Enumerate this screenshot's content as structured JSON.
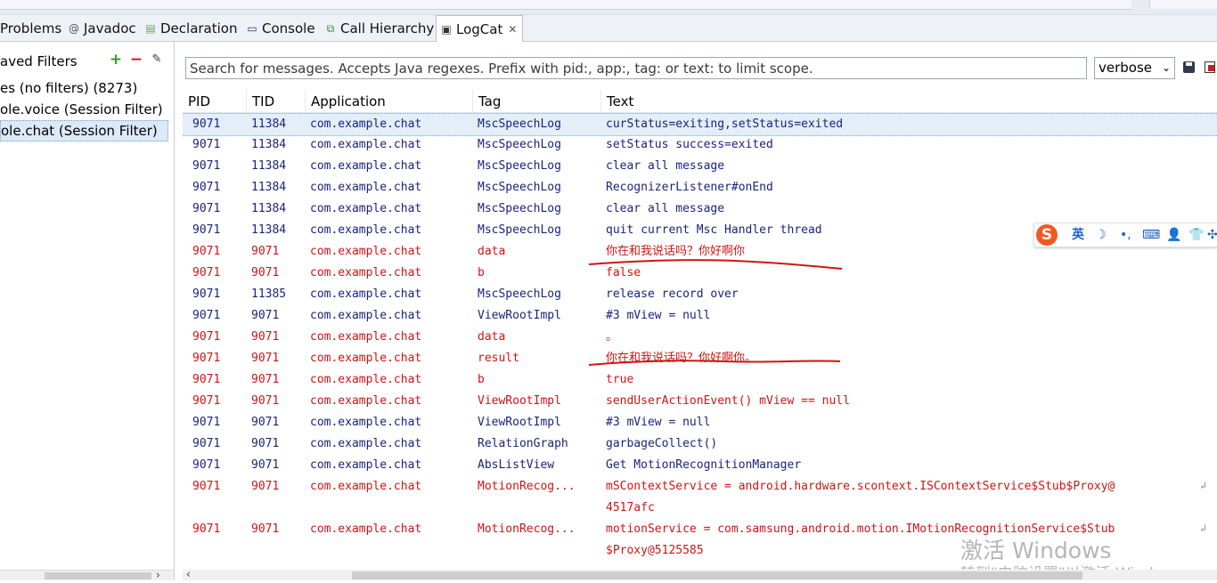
{
  "tabs": [
    {
      "label": "Problems",
      "icon": "problems-icon",
      "glyph": ""
    },
    {
      "label": "Javadoc",
      "icon": "javadoc-icon",
      "glyph": "@"
    },
    {
      "label": "Declaration",
      "icon": "declaration-icon",
      "glyph": "▤"
    },
    {
      "label": "Console",
      "icon": "console-icon",
      "glyph": "▭"
    },
    {
      "label": "Call Hierarchy",
      "icon": "call-hierarchy-icon",
      "glyph": "⧉"
    },
    {
      "label": "LogCat",
      "icon": "logcat-icon",
      "glyph": "▣",
      "close": "✕"
    }
  ],
  "filters": {
    "header": "aved Filters",
    "items": [
      "es (no filters) (8273)",
      "ole.voice (Session Filter)",
      "ole.chat (Session Filter)"
    ],
    "scroll_arrow": "›"
  },
  "search": {
    "placeholder": "Search for messages. Accepts Java regexes. Prefix with pid:, app:, tag: or text: to limit scope."
  },
  "log_level": {
    "value": "verbose"
  },
  "columns": [
    "PID",
    "TID",
    "Application",
    "Tag",
    "Text"
  ],
  "rows": [
    {
      "pid": "9071",
      "tid": "11384",
      "app": "com.example.chat",
      "tag": "MscSpeechLog",
      "text": "curStatus=exiting,setStatus=exited",
      "level": "d",
      "selected": true
    },
    {
      "pid": "9071",
      "tid": "11384",
      "app": "com.example.chat",
      "tag": "MscSpeechLog",
      "text": "setStatus success=exited",
      "level": "d"
    },
    {
      "pid": "9071",
      "tid": "11384",
      "app": "com.example.chat",
      "tag": "MscSpeechLog",
      "text": "clear all message",
      "level": "d"
    },
    {
      "pid": "9071",
      "tid": "11384",
      "app": "com.example.chat",
      "tag": "MscSpeechLog",
      "text": "RecognizerListener#onEnd",
      "level": "d"
    },
    {
      "pid": "9071",
      "tid": "11384",
      "app": "com.example.chat",
      "tag": "MscSpeechLog",
      "text": "clear all message",
      "level": "d"
    },
    {
      "pid": "9071",
      "tid": "11384",
      "app": "com.example.chat",
      "tag": "MscSpeechLog",
      "text": "quit current Msc Handler thread",
      "level": "d"
    },
    {
      "pid": "9071",
      "tid": "9071",
      "app": "com.example.chat",
      "tag": "data",
      "text": "你在和我说话吗？你好啊你",
      "level": "e"
    },
    {
      "pid": "9071",
      "tid": "9071",
      "app": "com.example.chat",
      "tag": "b",
      "text": "false",
      "level": "e"
    },
    {
      "pid": "9071",
      "tid": "11385",
      "app": "com.example.chat",
      "tag": "MscSpeechLog",
      "text": "release record over",
      "level": "d"
    },
    {
      "pid": "9071",
      "tid": "9071",
      "app": "com.example.chat",
      "tag": "ViewRootImpl",
      "text": "#3 mView = null",
      "level": "d"
    },
    {
      "pid": "9071",
      "tid": "9071",
      "app": "com.example.chat",
      "tag": "data",
      "text": "。",
      "level": "e"
    },
    {
      "pid": "9071",
      "tid": "9071",
      "app": "com.example.chat",
      "tag": "result",
      "text": "你在和我说话吗？你好啊你。",
      "level": "e"
    },
    {
      "pid": "9071",
      "tid": "9071",
      "app": "com.example.chat",
      "tag": "b",
      "text": "true",
      "level": "e"
    },
    {
      "pid": "9071",
      "tid": "9071",
      "app": "com.example.chat",
      "tag": "ViewRootImpl",
      "text": "sendUserActionEvent() mView == null",
      "level": "e"
    },
    {
      "pid": "9071",
      "tid": "9071",
      "app": "com.example.chat",
      "tag": "ViewRootImpl",
      "text": "#3 mView = null",
      "level": "d"
    },
    {
      "pid": "9071",
      "tid": "9071",
      "app": "com.example.chat",
      "tag": "RelationGraph",
      "text": "garbageCollect()",
      "level": "d"
    },
    {
      "pid": "9071",
      "tid": "9071",
      "app": "com.example.chat",
      "tag": "AbsListView",
      "text": "Get MotionRecognitionManager",
      "level": "d"
    },
    {
      "pid": "9071",
      "tid": "9071",
      "app": "com.example.chat",
      "tag": "MotionRecog...",
      "text": "mSContextService = android.hardware.scontext.ISContextService$Stub$Proxy@",
      "text2": "4517afc",
      "level": "e",
      "wrap": "↲"
    },
    {
      "pid": "9071",
      "tid": "9071",
      "app": "com.example.chat",
      "tag": "MotionRecog...",
      "text": "motionService = com.samsung.android.motion.IMotionRecognitionService$Stub",
      "text2": "$Proxy@5125585",
      "level": "e",
      "wrap": "↲"
    }
  ],
  "ime": {
    "logo": "S",
    "items": [
      "英",
      "☽",
      "•,",
      "⌨",
      "👤",
      "👕",
      "✣"
    ]
  },
  "watermark": {
    "line1": "激活 Windows",
    "line2": "转到\"电脑设置\"以激活 Windows。"
  },
  "colors": {
    "debug": "#1a237e",
    "error": "#d01414",
    "selection": "#e3eef9",
    "annotation": "#d01414"
  }
}
